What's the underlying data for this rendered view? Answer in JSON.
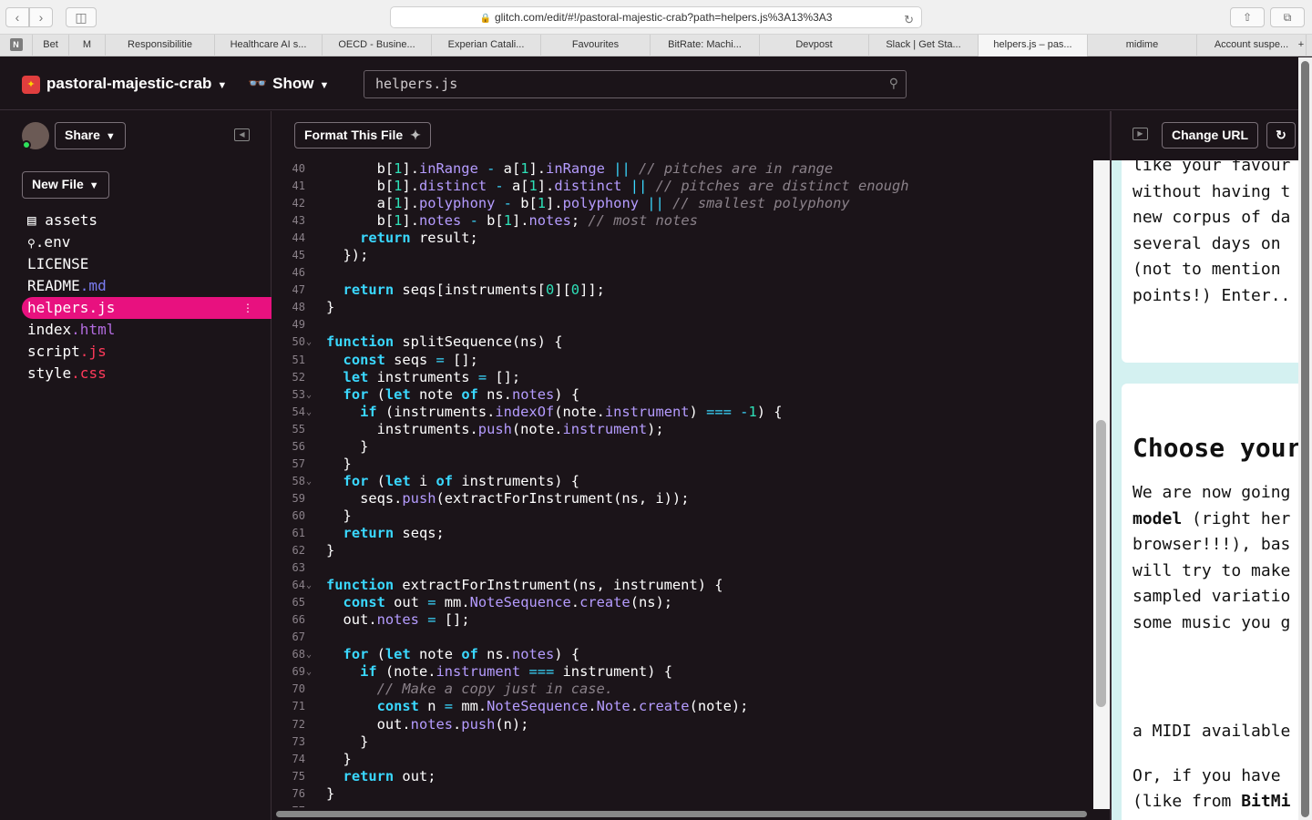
{
  "browser": {
    "url": "glitch.com/edit/#!/pastoral-majestic-crab?path=helpers.js%3A13%3A3",
    "tabs": [
      "Bet",
      "M",
      "Responsibilitie",
      "Healthcare AI s...",
      "OECD - Busine...",
      "Experian Catali...",
      "Favourites",
      "BitRate: Machi...",
      "Devpost",
      "Slack | Get Sta...",
      "helpers.js – pas...",
      "midime",
      "Account suspe..."
    ],
    "pinned_icon": "N"
  },
  "header": {
    "project_name": "pastoral-majestic-crab",
    "show_label": "Show",
    "search_value": "helpers.js"
  },
  "sidebar": {
    "share_label": "Share",
    "new_file_label": "New File",
    "files": [
      {
        "name": "assets",
        "ext": ""
      },
      {
        "name": ".env",
        "ext": ""
      },
      {
        "name": "LICENSE",
        "ext": ""
      },
      {
        "name": "README",
        "ext": ".md"
      },
      {
        "name": "helpers",
        "ext": ".js"
      },
      {
        "name": "index",
        "ext": ".html"
      },
      {
        "name": "script",
        "ext": ".js"
      },
      {
        "name": "style",
        "ext": ".css"
      }
    ]
  },
  "editor": {
    "format_label": "Format This File",
    "lines": [
      {
        "n": "40",
        "fold": false,
        "html": "      b[<span class='n'>1</span>].<span class='p'>inRange</span> <span class='o'>-</span> a[<span class='n'>1</span>].<span class='p'>inRange</span> <span class='o'>||</span> <span class='c'>// pitches are in range</span>"
      },
      {
        "n": "41",
        "fold": false,
        "html": "      b[<span class='n'>1</span>].<span class='p'>distinct</span> <span class='o'>-</span> a[<span class='n'>1</span>].<span class='p'>distinct</span> <span class='o'>||</span> <span class='c'>// pitches are distinct enough</span>"
      },
      {
        "n": "42",
        "fold": false,
        "html": "      a[<span class='n'>1</span>].<span class='p'>polyphony</span> <span class='o'>-</span> b[<span class='n'>1</span>].<span class='p'>polyphony</span> <span class='o'>||</span> <span class='c'>// smallest polyphony</span>"
      },
      {
        "n": "43",
        "fold": false,
        "html": "      b[<span class='n'>1</span>].<span class='p'>notes</span> <span class='o'>-</span> b[<span class='n'>1</span>].<span class='p'>notes</span>; <span class='c'>// most notes</span>"
      },
      {
        "n": "44",
        "fold": false,
        "html": "    <span class='k'>return</span> result;"
      },
      {
        "n": "45",
        "fold": false,
        "html": "  });"
      },
      {
        "n": "46",
        "fold": false,
        "html": ""
      },
      {
        "n": "47",
        "fold": false,
        "html": "  <span class='k'>return</span> seqs[instruments[<span class='n'>0</span>][<span class='n'>0</span>]];"
      },
      {
        "n": "48",
        "fold": false,
        "html": "}"
      },
      {
        "n": "49",
        "fold": false,
        "html": ""
      },
      {
        "n": "50",
        "fold": true,
        "html": "<span class='k'>function</span> splitSequence(ns) {"
      },
      {
        "n": "51",
        "fold": false,
        "html": "  <span class='k'>const</span> seqs <span class='o'>=</span> [];"
      },
      {
        "n": "52",
        "fold": false,
        "html": "  <span class='k'>let</span> instruments <span class='o'>=</span> [];"
      },
      {
        "n": "53",
        "fold": true,
        "html": "  <span class='k'>for</span> (<span class='k'>let</span> note <span class='k'>of</span> ns.<span class='p'>notes</span>) {"
      },
      {
        "n": "54",
        "fold": true,
        "html": "    <span class='k'>if</span> (instruments.<span class='p'>indexOf</span>(note.<span class='p'>instrument</span>) <span class='o'>===</span> <span class='o'>-</span><span class='n'>1</span>) {"
      },
      {
        "n": "55",
        "fold": false,
        "html": "      instruments.<span class='p'>push</span>(note.<span class='p'>instrument</span>);"
      },
      {
        "n": "56",
        "fold": false,
        "html": "    }"
      },
      {
        "n": "57",
        "fold": false,
        "html": "  }"
      },
      {
        "n": "58",
        "fold": true,
        "html": "  <span class='k'>for</span> (<span class='k'>let</span> i <span class='k'>of</span> instruments) {"
      },
      {
        "n": "59",
        "fold": false,
        "html": "    seqs.<span class='p'>push</span>(extractForInstrument(ns, i));"
      },
      {
        "n": "60",
        "fold": false,
        "html": "  }"
      },
      {
        "n": "61",
        "fold": false,
        "html": "  <span class='k'>return</span> seqs;"
      },
      {
        "n": "62",
        "fold": false,
        "html": "}"
      },
      {
        "n": "63",
        "fold": false,
        "html": ""
      },
      {
        "n": "64",
        "fold": true,
        "html": "<span class='k'>function</span> extractForInstrument(ns, instrument) {"
      },
      {
        "n": "65",
        "fold": false,
        "html": "  <span class='k'>const</span> out <span class='o'>=</span> mm.<span class='p'>NoteSequence</span>.<span class='p'>create</span>(ns);"
      },
      {
        "n": "66",
        "fold": false,
        "html": "  out.<span class='p'>notes</span> <span class='o'>=</span> [];"
      },
      {
        "n": "67",
        "fold": false,
        "html": ""
      },
      {
        "n": "68",
        "fold": true,
        "html": "  <span class='k'>for</span> (<span class='k'>let</span> note <span class='k'>of</span> ns.<span class='p'>notes</span>) {"
      },
      {
        "n": "69",
        "fold": true,
        "html": "    <span class='k'>if</span> (note.<span class='p'>instrument</span> <span class='o'>===</span> instrument) {"
      },
      {
        "n": "70",
        "fold": false,
        "html": "      <span class='c'>// Make a copy just in case.</span>"
      },
      {
        "n": "71",
        "fold": false,
        "html": "      <span class='k'>const</span> n <span class='o'>=</span> mm.<span class='p'>NoteSequence</span>.<span class='p'>Note</span>.<span class='p'>create</span>(note);"
      },
      {
        "n": "72",
        "fold": false,
        "html": "      out.<span class='p'>notes</span>.<span class='p'>push</span>(n);"
      },
      {
        "n": "73",
        "fold": false,
        "html": "    }"
      },
      {
        "n": "74",
        "fold": false,
        "html": "  }"
      },
      {
        "n": "75",
        "fold": false,
        "html": "  <span class='k'>return</span> out;"
      },
      {
        "n": "76",
        "fold": false,
        "html": "}"
      },
      {
        "n": "77",
        "fold": false,
        "html": ""
      }
    ]
  },
  "preview": {
    "change_url_label": "Change URL",
    "card1_lines": [
      "like your favour",
      "without having t",
      "new corpus of da",
      "several days on",
      "(not to mention",
      "points!) Enter.."
    ],
    "card2_heading": "Choose your",
    "card2_lines": [
      "We are now going",
      "model (right her",
      "browser!!!), bas",
      "will try to make",
      "sampled variatio",
      "some music you g"
    ],
    "card2_bold": [
      "model",
      "BitMi"
    ],
    "card2_tail": [
      "a MIDI available",
      "Or, if you have",
      "(like from BitMi"
    ]
  }
}
